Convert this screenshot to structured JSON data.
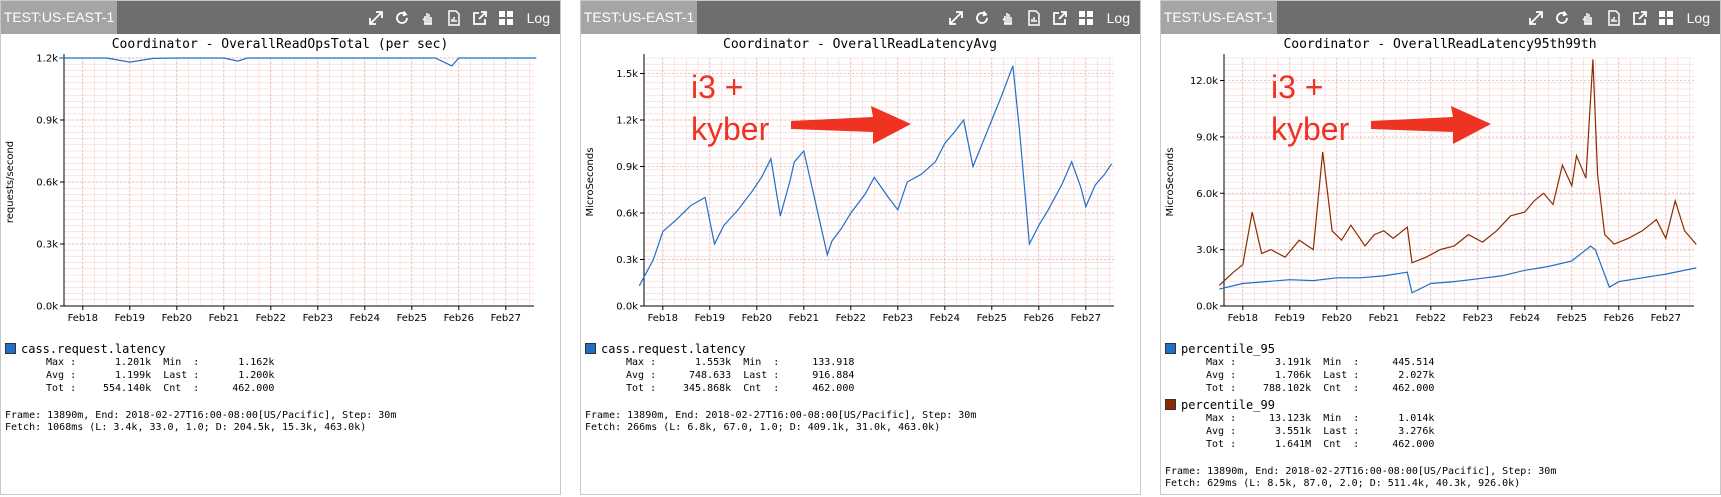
{
  "panels": [
    {
      "env_label": "TEST:US-EAST-1",
      "log_label": "Log",
      "icons": [
        "expand-icon",
        "refresh-icon",
        "hand-icon",
        "report-icon",
        "external-link-icon",
        "grid-icon"
      ],
      "title": "Coordinator - OverallReadOpsTotal (per sec)",
      "ylabel": "requests/second",
      "annotation": [],
      "legend": [
        {
          "name": "cass.request.latency",
          "color": "#1f6fc8",
          "max": "1.201k",
          "min": "1.162k",
          "avg": "1.199k",
          "last": "1.200k",
          "tot": "554.140k",
          "cnt": "462.000"
        }
      ],
      "footer": {
        "frame": "Frame: 13890m, End: 2018-02-27T16:00-08:00[US/Pacific], Step: 30m",
        "fetch": "Fetch: 1068ms (L: 3.4k, 33.0, 1.0; D: 204.5k, 15.3k, 463.0k)"
      }
    },
    {
      "env_label": "TEST:US-EAST-1",
      "log_label": "Log",
      "icons": [
        "expand-icon",
        "refresh-icon",
        "hand-icon",
        "report-icon",
        "external-link-icon",
        "grid-icon"
      ],
      "title": "Coordinator - OverallReadLatencyAvg",
      "ylabel": "MicroSeconds",
      "annotation": [
        "i3 +",
        "kyber"
      ],
      "legend": [
        {
          "name": "cass.request.latency",
          "color": "#1f6fc8",
          "max": "1.553k",
          "min": "133.918",
          "avg": "748.633",
          "last": "916.884",
          "tot": "345.868k",
          "cnt": "462.000"
        }
      ],
      "footer": {
        "frame": "Frame: 13890m, End: 2018-02-27T16:00-08:00[US/Pacific], Step: 30m",
        "fetch": "Fetch: 266ms (L: 6.8k, 67.0, 1.0; D: 409.1k, 31.0k, 463.0k)"
      }
    },
    {
      "env_label": "TEST:US-EAST-1",
      "log_label": "Log",
      "icons": [
        "expand-icon",
        "refresh-icon",
        "hand-icon",
        "report-icon",
        "external-link-icon",
        "grid-icon"
      ],
      "title": "Coordinator - OverallReadLatency95th99th",
      "ylabel": "MicroSeconds",
      "annotation": [
        "i3 +",
        "kyber"
      ],
      "legend": [
        {
          "name": "percentile_95",
          "color": "#1f6fc8",
          "max": "3.191k",
          "min": "445.514",
          "avg": "1.706k",
          "last": "2.027k",
          "tot": "788.102k",
          "cnt": "462.000"
        },
        {
          "name": "percentile_99",
          "color": "#8b2c00",
          "max": "13.123k",
          "min": "1.014k",
          "avg": "3.551k",
          "last": "3.276k",
          "tot": "1.641M",
          "cnt": "462.000"
        }
      ],
      "footer": {
        "frame": "Frame: 13890m, End: 2018-02-27T16:00-08:00[US/Pacific], Step: 30m",
        "fetch": "Fetch: 629ms (L: 8.5k, 87.0, 2.0; D: 511.4k, 40.3k, 926.0k)"
      }
    }
  ],
  "chart_data": [
    {
      "type": "line",
      "title": "Coordinator - OverallReadOpsTotal (per sec)",
      "xlabel": "",
      "ylabel": "requests/second",
      "x_ticks": [
        "Feb18",
        "Feb19",
        "Feb20",
        "Feb21",
        "Feb22",
        "Feb23",
        "Feb24",
        "Feb25",
        "Feb26",
        "Feb27"
      ],
      "y_ticks": [
        "0.0k",
        "0.3k",
        "0.6k",
        "0.9k",
        "1.2k"
      ],
      "ylim": [
        0,
        1200
      ],
      "grid": true,
      "series": [
        {
          "name": "cass.request.latency",
          "color": "#1f6fc8",
          "x": [
            17.5,
            18.0,
            18.5,
            19.0,
            19.5,
            20.0,
            20.5,
            21.0,
            21.3,
            21.5,
            22.0,
            22.5,
            23.0,
            23.5,
            24.0,
            24.5,
            25.0,
            25.5,
            25.85,
            26.0,
            26.5,
            27.0,
            27.65
          ],
          "values": [
            1200,
            1200,
            1200,
            1180,
            1198,
            1200,
            1200,
            1200,
            1185,
            1200,
            1200,
            1200,
            1200,
            1200,
            1200,
            1200,
            1200,
            1200,
            1162,
            1200,
            1200,
            1200,
            1200
          ]
        }
      ]
    },
    {
      "type": "line",
      "title": "Coordinator - OverallReadLatencyAvg",
      "xlabel": "",
      "ylabel": "MicroSeconds",
      "x_ticks": [
        "Feb18",
        "Feb19",
        "Feb20",
        "Feb21",
        "Feb22",
        "Feb23",
        "Feb24",
        "Feb25",
        "Feb26",
        "Feb27"
      ],
      "y_ticks": [
        "0.0k",
        "0.3k",
        "0.6k",
        "0.9k",
        "1.2k",
        "1.5k"
      ],
      "ylim": [
        0,
        1600
      ],
      "grid": true,
      "series": [
        {
          "name": "cass.request.latency",
          "color": "#1f6fc8",
          "x": [
            17.5,
            17.8,
            18.0,
            18.3,
            18.6,
            18.9,
            19.1,
            19.3,
            19.6,
            19.9,
            20.1,
            20.3,
            20.5,
            20.7,
            20.8,
            21.0,
            21.3,
            21.5,
            21.6,
            21.8,
            22.0,
            22.3,
            22.5,
            22.8,
            23.0,
            23.2,
            23.5,
            23.8,
            24.0,
            24.2,
            24.4,
            24.6,
            24.8,
            25.0,
            25.2,
            25.45,
            25.6,
            25.8,
            26.0,
            26.2,
            26.5,
            26.7,
            26.9,
            27.0,
            27.2,
            27.4,
            27.55
          ],
          "values": [
            130,
            300,
            480,
            560,
            650,
            700,
            400,
            520,
            620,
            740,
            830,
            950,
            580,
            800,
            930,
            1000,
            600,
            330,
            420,
            500,
            600,
            720,
            830,
            700,
            620,
            800,
            850,
            930,
            1050,
            1120,
            1200,
            900,
            1050,
            1200,
            1350,
            1550,
            1100,
            400,
            520,
            620,
            790,
            930,
            760,
            640,
            780,
            850,
            917
          ]
        }
      ]
    },
    {
      "type": "line",
      "title": "Coordinator - OverallReadLatency95th99th",
      "xlabel": "",
      "ylabel": "MicroSeconds",
      "x_ticks": [
        "Feb18",
        "Feb19",
        "Feb20",
        "Feb21",
        "Feb22",
        "Feb23",
        "Feb24",
        "Feb25",
        "Feb26",
        "Feb27"
      ],
      "y_ticks": [
        "0.0k",
        "3.0k",
        "6.0k",
        "9.0k",
        "12.0k"
      ],
      "ylim": [
        0,
        13200
      ],
      "grid": true,
      "series": [
        {
          "name": "percentile_95",
          "color": "#1f6fc8",
          "x": [
            17.5,
            18.0,
            18.5,
            19.0,
            19.5,
            20.0,
            20.5,
            21.0,
            21.5,
            21.6,
            22.0,
            22.5,
            23.0,
            23.5,
            24.0,
            24.5,
            25.0,
            25.4,
            25.5,
            25.8,
            26.0,
            26.5,
            27.0,
            27.65
          ],
          "values": [
            900,
            1200,
            1300,
            1400,
            1350,
            1500,
            1500,
            1600,
            1800,
            700,
            1200,
            1300,
            1450,
            1600,
            1900,
            2100,
            2400,
            3190,
            3000,
            1000,
            1300,
            1500,
            1700,
            2027
          ]
        },
        {
          "name": "percentile_99",
          "color": "#8b2c00",
          "x": [
            17.5,
            17.8,
            18.0,
            18.2,
            18.4,
            18.6,
            18.9,
            19.2,
            19.5,
            19.7,
            19.9,
            20.1,
            20.3,
            20.6,
            20.8,
            21.0,
            21.2,
            21.5,
            21.6,
            21.9,
            22.2,
            22.5,
            22.8,
            23.1,
            23.4,
            23.7,
            24.0,
            24.2,
            24.4,
            24.6,
            24.8,
            25.0,
            25.1,
            25.3,
            25.45,
            25.55,
            25.7,
            25.9,
            26.2,
            26.5,
            26.8,
            27.0,
            27.2,
            27.4,
            27.65
          ],
          "values": [
            1100,
            1800,
            2200,
            5000,
            2800,
            3000,
            2600,
            3500,
            3000,
            8200,
            4000,
            3500,
            4300,
            3200,
            3800,
            4000,
            3600,
            4200,
            2300,
            2600,
            3000,
            3200,
            3800,
            3400,
            4000,
            4800,
            5000,
            5600,
            6000,
            5400,
            7500,
            6400,
            8000,
            6800,
            13123,
            7000,
            3800,
            3300,
            3600,
            4000,
            4600,
            3600,
            5600,
            4000,
            3276
          ]
        }
      ]
    }
  ]
}
